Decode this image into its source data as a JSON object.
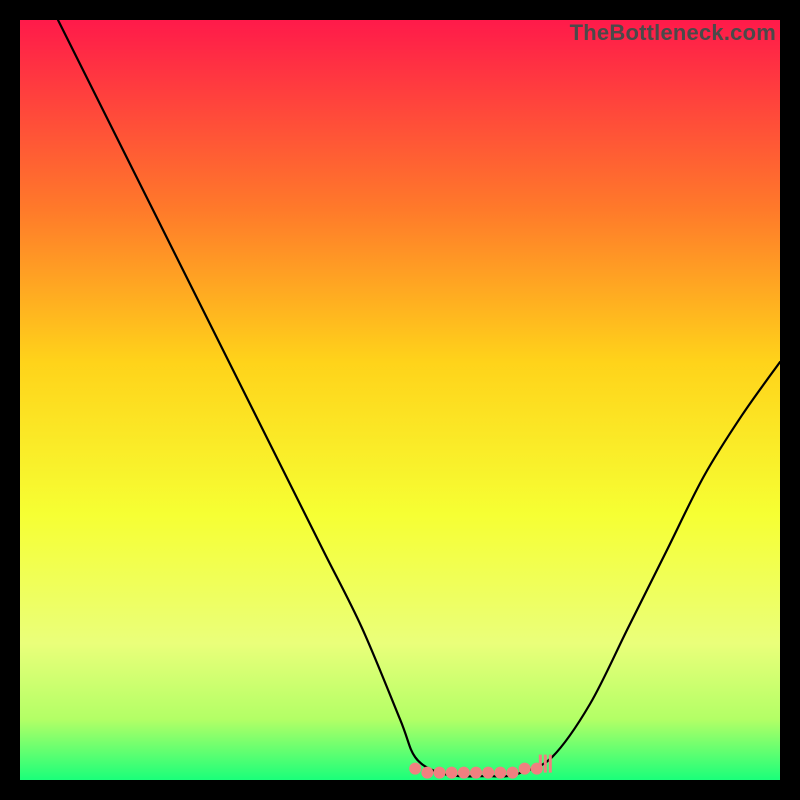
{
  "watermark": "TheBottleneck.com",
  "colors": {
    "background": "#000000",
    "gradient_top": "#ff1a4a",
    "gradient_mid1": "#ff7a2a",
    "gradient_mid2": "#ffd31a",
    "gradient_mid3": "#f6ff33",
    "gradient_bottom1": "#d8ff66",
    "gradient_bottom2": "#8bff66",
    "gradient_bottom3": "#1aff7a",
    "curve": "#000000",
    "highlight": "#f08080"
  },
  "chart_data": {
    "type": "line",
    "title": "",
    "xlabel": "",
    "ylabel": "",
    "xlim": [
      0,
      100
    ],
    "ylim": [
      0,
      100
    ],
    "series": [
      {
        "name": "bottleneck-curve",
        "x": [
          5,
          10,
          15,
          20,
          25,
          30,
          35,
          40,
          45,
          50,
          52,
          55,
          58,
          60,
          62,
          64,
          66,
          70,
          75,
          80,
          85,
          90,
          95,
          100
        ],
        "y": [
          100,
          90,
          80,
          70,
          60,
          50,
          40,
          30,
          20,
          8,
          3,
          1,
          0.5,
          0.5,
          0.5,
          0.5,
          1,
          3,
          10,
          20,
          30,
          40,
          48,
          55
        ]
      }
    ],
    "highlight_region": {
      "x_start": 52,
      "x_end": 68,
      "y": 1.5
    }
  }
}
